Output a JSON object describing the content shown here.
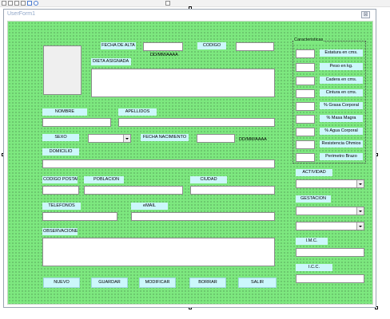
{
  "window": {
    "title": "UserForm1",
    "close_glyph": "⊠"
  },
  "toolbar": {
    "icons": [
      "save-icon",
      "undo-icon",
      "redo-icon",
      "run-icon",
      "break-icon",
      "design-icon",
      "help-icon"
    ]
  },
  "labels": {
    "fecha_alta": "FECHA DE ALTA",
    "date_format_1": "DD/MM/AAAA",
    "codigo": "CODIGO",
    "dieta": "DIETA ASIGNADA",
    "nombre": "NOMBRE",
    "apellidos": "APELLIDOS",
    "sexo": "SEXO",
    "fecha_nac": "FECHA NACIMIENTO",
    "date_format_2": "DD/MM/AAAA",
    "domicilio": "DOMICILIO",
    "cp": "CODIGO POSTAL",
    "poblacion": "POBLACION",
    "ciudad": "CIUDAD",
    "telefonos": "TELEFONOS",
    "email": "eMAIL",
    "observaciones": "OBSERVACIONES"
  },
  "caracteristicas": {
    "title": "Caracteristicas",
    "items": [
      "Estatura en cms.",
      "Peso en kg.",
      "Cadera en cms.",
      "Cintura en cms.",
      "% Grasa Corporal",
      "% Masa Magra",
      "% Agua Corporal",
      "Resistencia Ohmios",
      "Perimetro Brazo"
    ]
  },
  "right_labels": {
    "actividad": "ACTIVIDAD",
    "gestacion": "GESTACION",
    "imc": "I.M.C.",
    "icc": "I.C.C."
  },
  "buttons": {
    "nuevo": "NUEVO",
    "guardar": "GUARDAR",
    "modificar": "MODIFICAR",
    "borrar": "BORRAR",
    "salir": "SALIR"
  },
  "colors": {
    "form_bg": "#7de87f",
    "label_bg": "#ccf7fb",
    "title_text": "#8fa6c8"
  }
}
